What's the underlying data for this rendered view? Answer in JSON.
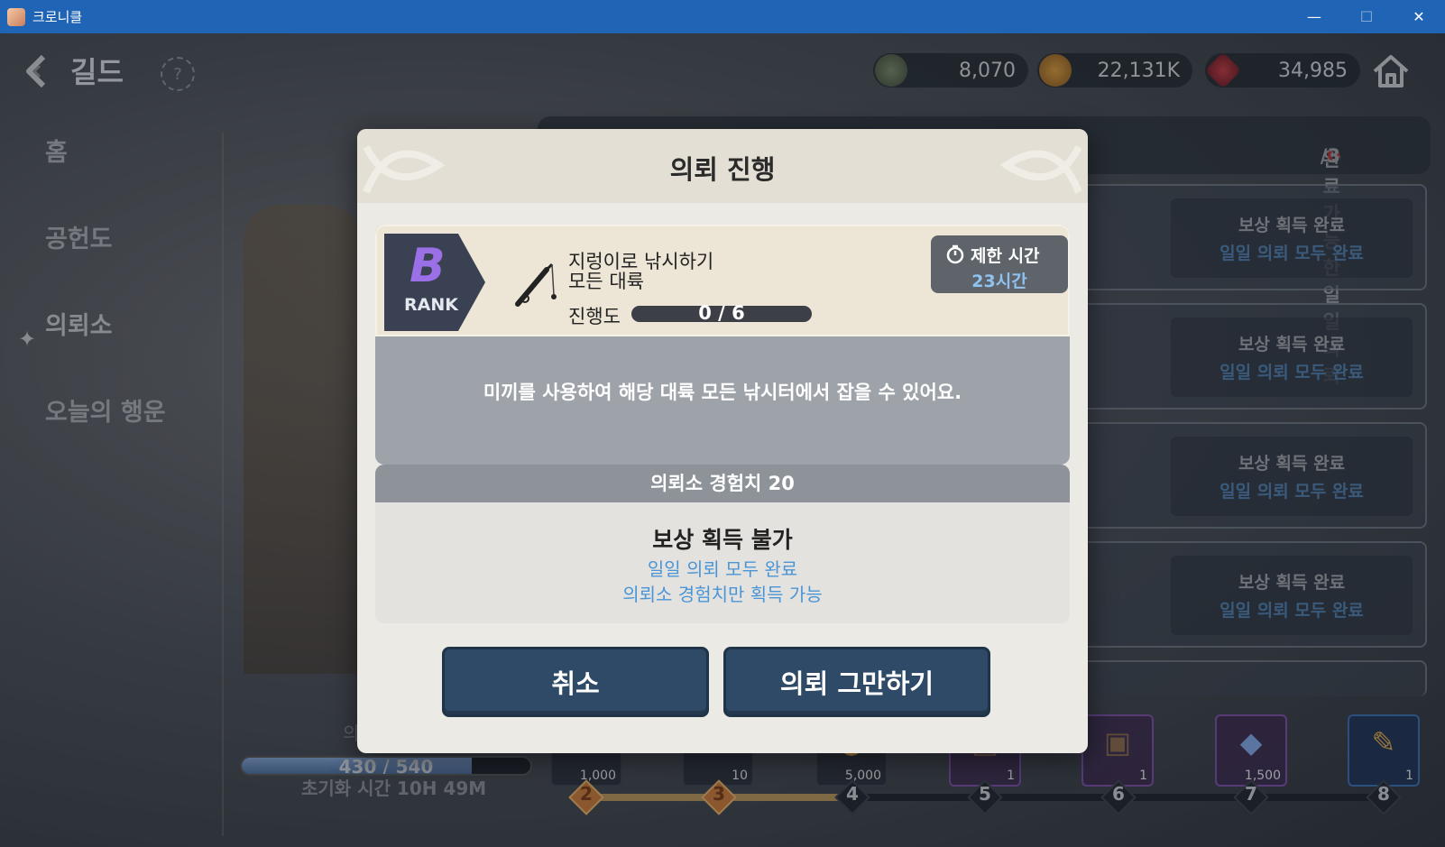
{
  "window": {
    "title": "크로니클",
    "controls": [
      "—",
      "☐",
      "✕"
    ]
  },
  "header": {
    "title": "길드",
    "currencies": [
      {
        "icon": "guild-medal-icon",
        "value": "8,070"
      },
      {
        "icon": "gold-coin-icon",
        "value": "22,131K"
      },
      {
        "icon": "red-gem-icon",
        "value": "34,985"
      }
    ]
  },
  "sidebar": {
    "items": [
      {
        "label": "홈",
        "active": false
      },
      {
        "label": "공헌도",
        "active": false
      },
      {
        "label": "의뢰소",
        "active": true
      },
      {
        "label": "오늘의 행운",
        "active": false
      }
    ]
  },
  "daily": {
    "label": "완료 가능한 일일 의뢰 ",
    "done": "0",
    "total": "/3"
  },
  "cards": [
    {
      "l1": "보상 획득 완료",
      "l2": "일일 의뢰 모두 완료"
    },
    {
      "l1": "보상 획득 완료",
      "l2": "일일 의뢰 모두 완료"
    },
    {
      "l1": "보상 획득 완료",
      "l2": "일일 의뢰 모두 완료"
    },
    {
      "l1": "보상 획득 완료",
      "l2": "일일 의뢰 모두 완료"
    }
  ],
  "bottom": {
    "label": "의",
    "progress": {
      "current": 430,
      "max": 540,
      "text": "430 / 540"
    },
    "reset": "초기화 시간 10H 49M",
    "milestones": [
      "2",
      "3",
      "4",
      "5",
      "6",
      "7",
      "8"
    ],
    "rewards": [
      {
        "count": "1,000",
        "icon": "check-icon"
      },
      {
        "count": "10",
        "icon": "check-icon"
      },
      {
        "count": "5,000",
        "icon": "gold-coin-icon"
      },
      {
        "count": "1",
        "icon": "chest-icon"
      },
      {
        "count": "1",
        "icon": "chest-icon"
      },
      {
        "count": "1,500",
        "icon": "crystal-icon"
      },
      {
        "count": "1",
        "icon": "scroll-icon"
      }
    ]
  },
  "modal": {
    "title": "의뢰 진행",
    "quest": {
      "rank_letter": "B",
      "rank_word": "RANK",
      "name_line1": "지렁이로 낚시하기",
      "name_line2": "모든 대륙",
      "progress_label": "진행도",
      "progress": "0 / 6",
      "limit_label": "제한 시간",
      "limit_value": "23시간",
      "description": "미끼를 사용하여 해당 대륙 모든 낚시터에서 잡을 수 있어요."
    },
    "reward": {
      "header": "의뢰소 경험치 20",
      "main": "보상 획득 불가",
      "sub1": "일일 의뢰 모두 완료",
      "sub2": "의뢰소 경험치만 획득 가능"
    },
    "buttons": {
      "cancel": "취소",
      "stop": "의뢰 그만하기"
    }
  }
}
